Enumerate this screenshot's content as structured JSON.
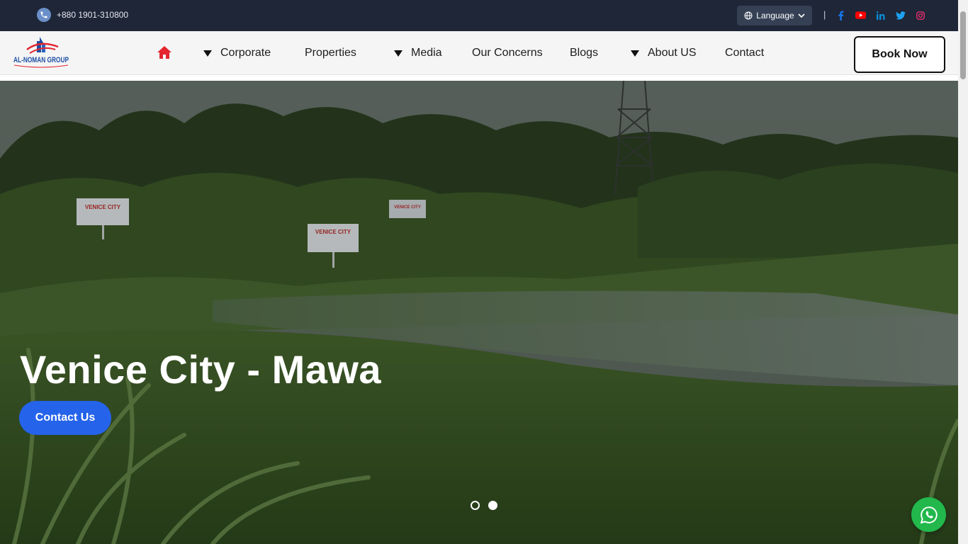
{
  "topbar": {
    "phone": "+880 1901-310800",
    "language_label": "Language",
    "separator": "|",
    "socials": [
      "facebook-icon",
      "youtube-icon",
      "linkedin-icon",
      "twitter-icon",
      "instagram-icon"
    ]
  },
  "brand": {
    "logo_text": "AL-NOMAN GROUP"
  },
  "nav": {
    "items": [
      {
        "label": "Corporate",
        "dropdown": true
      },
      {
        "label": "Properties",
        "dropdown": false
      },
      {
        "label": "Media",
        "dropdown": true
      },
      {
        "label": "Our Concerns",
        "dropdown": false
      },
      {
        "label": "Blogs",
        "dropdown": false
      },
      {
        "label": "About US",
        "dropdown": true
      },
      {
        "label": "Contact",
        "dropdown": false
      }
    ],
    "cta": "Book Now"
  },
  "hero": {
    "title": "Venice City - Mawa",
    "button": "Contact Us",
    "slides": 2,
    "active_slide": 2,
    "sign_text": "VENICE CITY"
  },
  "colors": {
    "topbar_bg": "#1e2637",
    "accent_blue": "#2563eb",
    "home_red": "#e3262f",
    "whatsapp_green": "#22b84c"
  }
}
